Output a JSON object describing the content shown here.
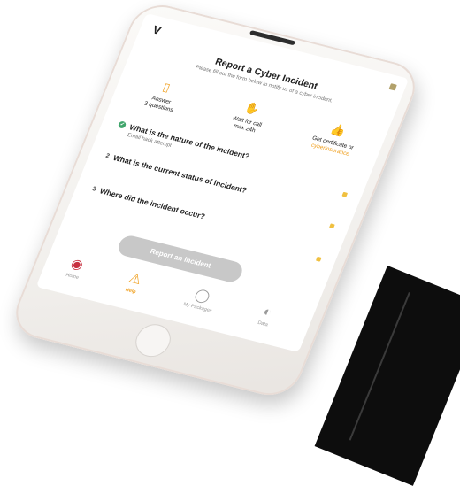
{
  "app": {
    "logo": "V",
    "logo_suffix": "",
    "title": "Report a Cyber Incident",
    "subtitle": "Please fill out the form below to notify us of a cyber incident."
  },
  "steps": [
    {
      "icon": "phone-icon",
      "label_line1": "Answer",
      "label_line2": "3 questions"
    },
    {
      "icon": "hand-icon",
      "label_line1": "Wait for call",
      "label_line2": "max 24h"
    },
    {
      "icon": "thumbs-up-icon",
      "label_line1": "Get certificate or",
      "label_line2": "cyberinsurance"
    }
  ],
  "questions": [
    {
      "number": "",
      "text": "What is the nature of the incident?",
      "answer": "Email hack attempt",
      "answered": true
    },
    {
      "number": "2",
      "text": "What is the current status of incident?",
      "answer": "",
      "answered": false
    },
    {
      "number": "3",
      "text": "Where did the incident occur?",
      "answer": "",
      "answered": false
    }
  ],
  "actions": {
    "report_button": "Report an incident"
  },
  "tabs": [
    {
      "icon": "badge-icon",
      "label": "Home"
    },
    {
      "icon": "warning-icon",
      "label": "Help"
    },
    {
      "icon": "chat-icon",
      "label": "My Packages"
    },
    {
      "icon": "user-icon",
      "label": "Data"
    }
  ],
  "colors": {
    "accent": "#f0a020",
    "success": "#3fa56b",
    "alert": "#c83040",
    "button_disabled": "#c8c8c8"
  }
}
